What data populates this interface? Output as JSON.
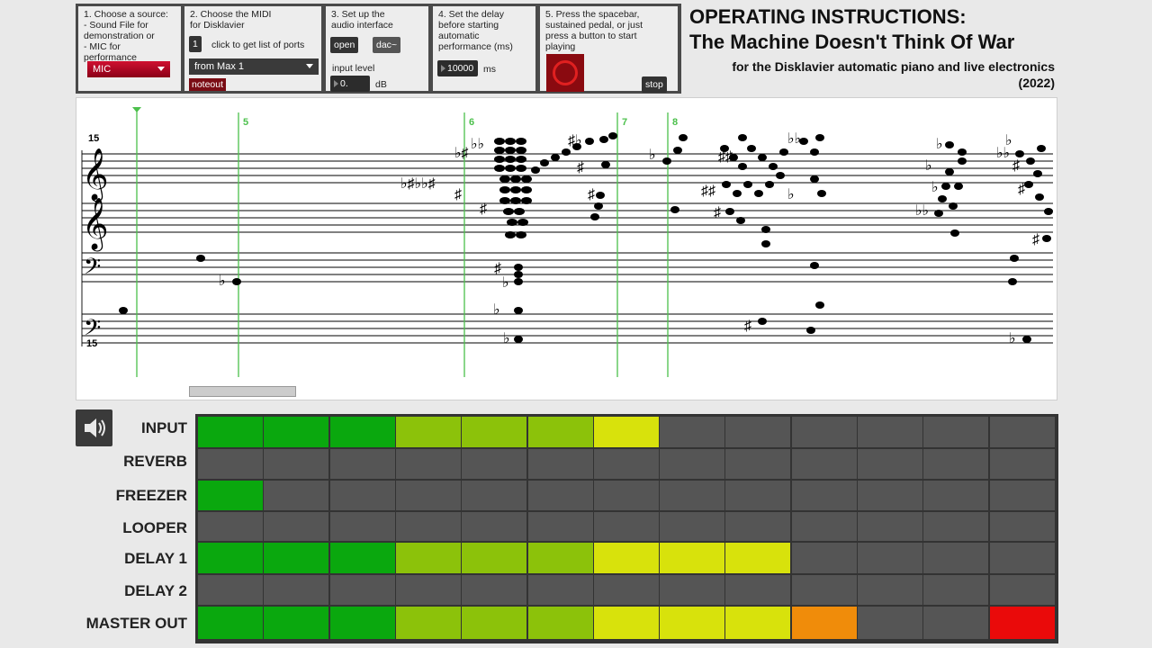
{
  "panels": {
    "p1": {
      "text": "1. Choose a source:\n- Sound File for\ndemonstration or\n- MIC for performance",
      "menu": "MIC"
    },
    "p2": {
      "text": "2. Choose the MIDI\nfor Disklavier",
      "button": "1",
      "hint": "click to get list of ports",
      "menu": "from Max 1",
      "noteout": "noteout"
    },
    "p3": {
      "text": "3. Set up the\naudio interface",
      "open": "open",
      "dac": "dac~",
      "level_label": "input level",
      "level_value": "0.",
      "level_unit": "dB"
    },
    "p4": {
      "text": "4. Set the delay\nbefore starting\nautomatic\nperformance (ms)",
      "value": "10000",
      "unit": "ms"
    },
    "p5": {
      "text": "5. Press the spacebar,\nsustained pedal, or just\npress a button to start\nplaying",
      "stop": "stop"
    }
  },
  "title": {
    "line1": "OPERATING INSTRUCTIONS:",
    "line2": "The Machine Doesn't Think Of War",
    "line3": "for the Disklavier automatic piano and live electronics",
    "line4": "(2022)"
  },
  "score": {
    "ottava_top": "15",
    "ottava_bottom": "15",
    "markers": [
      "5",
      "6",
      "7",
      "8"
    ]
  },
  "meters": {
    "rows": [
      {
        "label": "INPUT",
        "levels": [
          "g",
          "g",
          "g",
          "lg",
          "lg",
          "lg",
          "y",
          "n",
          "n",
          "n",
          "n",
          "n",
          "n"
        ]
      },
      {
        "label": "REVERB",
        "levels": [
          "n",
          "n",
          "n",
          "n",
          "n",
          "n",
          "n",
          "n",
          "n",
          "n",
          "n",
          "n",
          "n"
        ]
      },
      {
        "label": "FREEZER",
        "levels": [
          "g",
          "n",
          "n",
          "n",
          "n",
          "n",
          "n",
          "n",
          "n",
          "n",
          "n",
          "n",
          "n"
        ]
      },
      {
        "label": "LOOPER",
        "levels": [
          "n",
          "n",
          "n",
          "n",
          "n",
          "n",
          "n",
          "n",
          "n",
          "n",
          "n",
          "n",
          "n"
        ]
      },
      {
        "label": "DELAY 1",
        "levels": [
          "g",
          "g",
          "g",
          "lg",
          "lg",
          "lg",
          "y",
          "y",
          "y",
          "n",
          "n",
          "n",
          "n"
        ]
      },
      {
        "label": "DELAY 2",
        "levels": [
          "n",
          "n",
          "n",
          "n",
          "n",
          "n",
          "n",
          "n",
          "n",
          "n",
          "n",
          "n",
          "n"
        ]
      },
      {
        "label": "MASTER OUT",
        "levels": [
          "g",
          "g",
          "g",
          "lg",
          "lg",
          "lg",
          "y",
          "y",
          "y",
          "o",
          "n",
          "n",
          "r"
        ]
      }
    ],
    "colors": {
      "g": "#0aa80e",
      "lg": "#8cc20a",
      "y": "#d8e20c",
      "o": "#f08c0a",
      "r": "#ea0a0a",
      "n": "#555555"
    }
  },
  "icons": {
    "speaker": "speaker-icon",
    "record": "record-circle-icon"
  }
}
